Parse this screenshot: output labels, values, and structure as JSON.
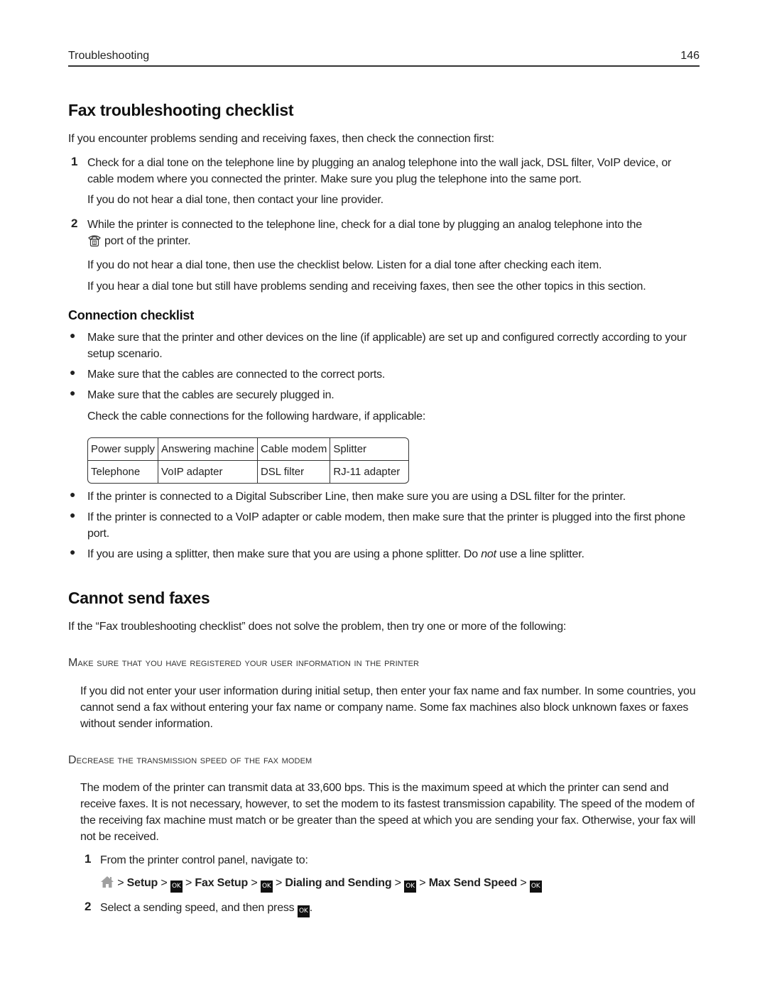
{
  "header": {
    "section": "Troubleshooting",
    "page_number": "146"
  },
  "fax_checklist": {
    "title": "Fax troubleshooting checklist",
    "intro": "If you encounter problems sending and receiving faxes, then check the connection first:",
    "steps": [
      {
        "number": "1",
        "text": "Check for a dial tone on the telephone line by plugging an analog telephone into the wall jack, DSL filter, VoIP device, or cable modem where you connected the printer. Make sure you plug the telephone into the same port.",
        "notes": [
          "If you do not hear a dial tone, then contact your line provider."
        ]
      },
      {
        "number": "2",
        "text_before_icon": "While the printer is connected to the telephone line, check for a dial tone by plugging an analog telephone into the",
        "icon": "phone-port-icon",
        "text_after_icon": "port of the printer.",
        "notes": [
          "If you do not hear a dial tone, then use the checklist below. Listen for a dial tone after checking each item.",
          "If you hear a dial tone but still have problems sending and receiving faxes, then see the other topics in this section."
        ]
      }
    ]
  },
  "connection_checklist": {
    "title": "Connection checklist",
    "bullets_top": [
      "Make sure that the printer and other devices on the line (if applicable) are set up and configured correctly according to your setup scenario.",
      "Make sure that the cables are connected to the correct ports.",
      "Make sure that the cables are securely plugged in."
    ],
    "hardware_intro": "Check the cable connections for the following hardware, if applicable:",
    "hardware_table": [
      [
        "Power supply",
        "Answering machine",
        "Cable modem",
        "Splitter"
      ],
      [
        "Telephone",
        "VoIP adapter",
        "DSL filter",
        "RJ-11 adapter"
      ]
    ],
    "bullets_bottom": [
      "If the printer is connected to a Digital Subscriber Line, then make sure you are using a DSL filter for the printer.",
      "If the printer is connected to a VoIP adapter or cable modem, then make sure that the printer is plugged into the first phone port."
    ],
    "splitter_bullet": {
      "before": "If you are using a splitter, then make sure that you are using a phone splitter. Do ",
      "emphasis": "not",
      "after": " use a line splitter."
    }
  },
  "cannot_send": {
    "title": "Cannot send faxes",
    "intro": "If the “Fax troubleshooting checklist” does not solve the problem, then try one or more of the following:",
    "solutions": [
      {
        "heading": "Make sure that you have registered your user information in the printer",
        "body": "If you did not enter your user information during initial setup, then enter your fax name and fax number. In some countries, you cannot send a fax without entering your fax name or company name. Some fax machines also block unknown faxes or faxes without sender information."
      },
      {
        "heading": "Decrease the transmission speed of the fax modem",
        "body": "The modem of the printer can transmit data at 33,600 bps. This is the maximum speed at which the printer can send and receive faxes. It is not necessary, however, to set the modem to its fastest transmission capability. The speed of the modem of the receiving fax machine must match or be greater than the speed at which you are sending your fax. Otherwise, your fax will not be received.",
        "steps": [
          {
            "number": "1",
            "text": "From the printer control panel, navigate to:"
          },
          {
            "number": "2",
            "text_before": "Select a sending speed, and then press",
            "text_after": "."
          }
        ],
        "nav_path": {
          "separator": ">",
          "ok_label": "OK",
          "items": [
            "Setup",
            "Fax Setup",
            "Dialing and Sending",
            "Max Send Speed"
          ]
        }
      }
    ]
  },
  "colors": {
    "text": "#222222",
    "heading": "#111111",
    "home_icon": "#999999",
    "ok_button_bg": "#111111",
    "ok_button_fg": "#ffffff"
  }
}
